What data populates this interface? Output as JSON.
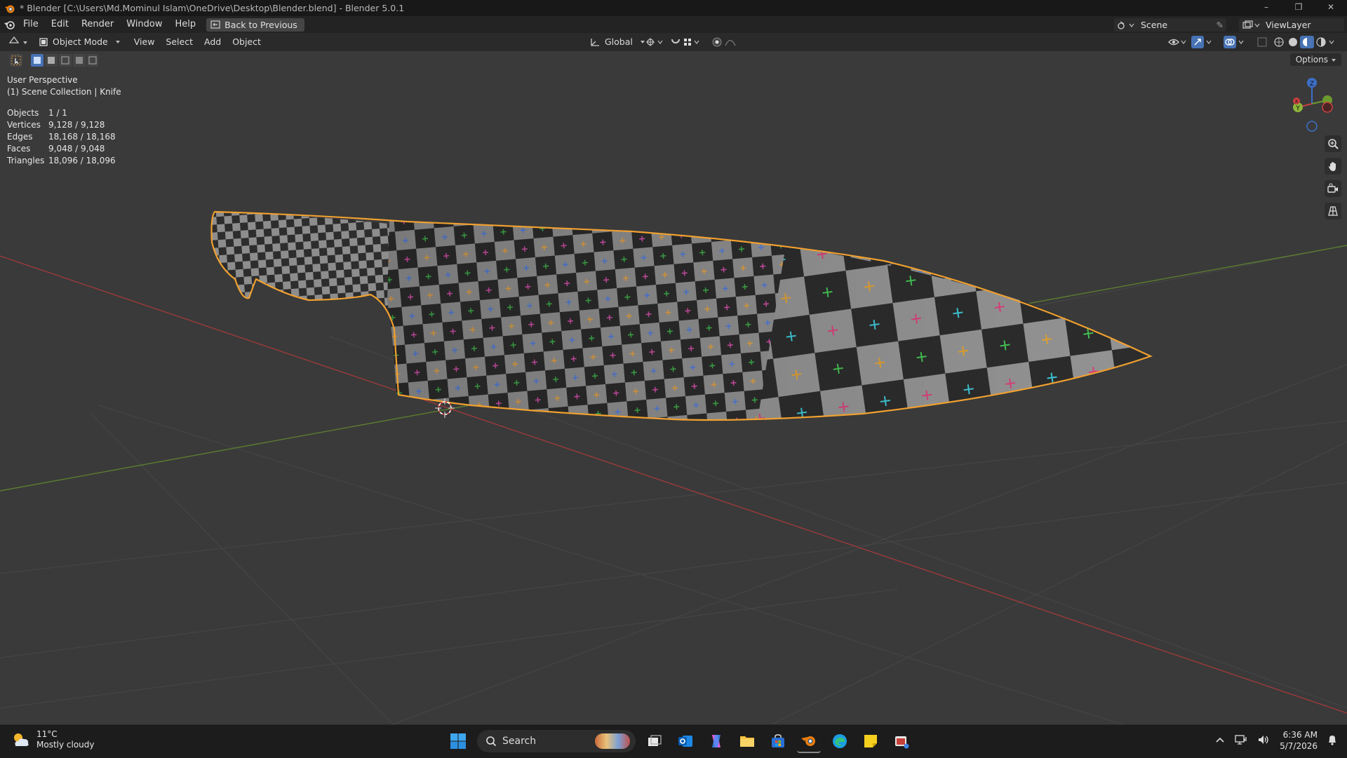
{
  "window": {
    "title": "* Blender [C:\\Users\\Md.Mominul Islam\\OneDrive\\Desktop\\Blender.blend] - Blender 5.0.1",
    "controls": [
      "–",
      "❐",
      "✕"
    ]
  },
  "menubar": {
    "items": [
      "File",
      "Edit",
      "Render",
      "Window",
      "Help"
    ],
    "back_label": "Back to Previous",
    "scene": "Scene",
    "view_layer": "ViewLayer"
  },
  "header": {
    "mode": "Object Mode",
    "menus": [
      "View",
      "Select",
      "Add",
      "Object"
    ],
    "transform_orientation": "Global",
    "options_label": "Options"
  },
  "overlay": {
    "perspective": "User Perspective",
    "collection": "(1) Scene Collection | Knife",
    "stats": [
      {
        "label": "Objects",
        "value": "1 / 1"
      },
      {
        "label": "Vertices",
        "value": "9,128 / 9,128"
      },
      {
        "label": "Edges",
        "value": "18,168 / 18,168"
      },
      {
        "label": "Faces",
        "value": "9,048 / 9,048"
      },
      {
        "label": "Triangles",
        "value": "18,096 / 18,096"
      }
    ]
  },
  "gizmo": {
    "x": "X",
    "y": "Y",
    "z": "Z"
  },
  "colors": {
    "selection_outline": "#f0a030",
    "x_axis": "#c8413f",
    "y_axis": "#6c9a2e",
    "z_axis": "#3d6fc8",
    "viewport_bg": "#3a3a3a"
  },
  "taskbar": {
    "temperature": "11°C",
    "condition": "Mostly cloudy",
    "search_placeholder": "Search",
    "time": "6:36 AM",
    "date": "5/7/2026"
  }
}
